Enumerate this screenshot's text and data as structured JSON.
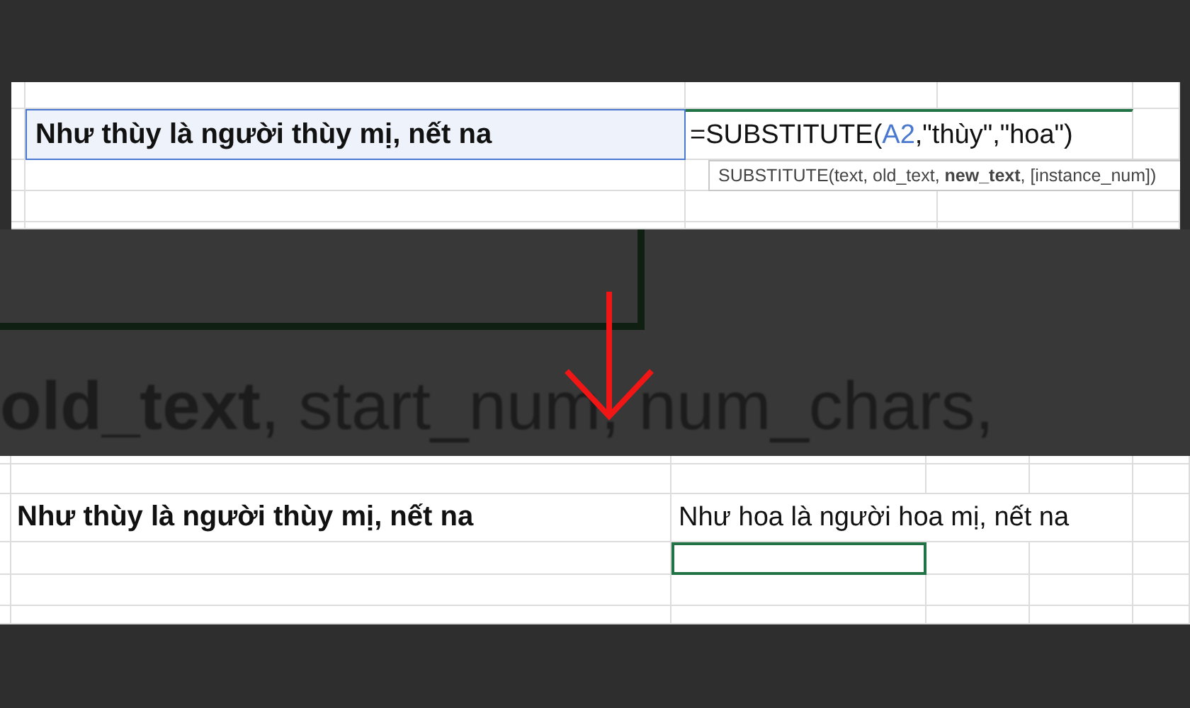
{
  "top_sheet": {
    "source_cell": {
      "text": "Như thùy là người thùy mị, nết na",
      "selected": true
    },
    "formula_cell": {
      "prefix": "=SUBSTITUTE(",
      "reference": "A2",
      "rest": ",\"thùy\",\"hoa\")"
    },
    "tooltip": "SUBSTITUTE(text, old_text, **new_text**, [instance_num])"
  },
  "blurred_hint": "**old_text**, start_num, num_chars,",
  "bottom_sheet": {
    "source_cell": {
      "text": "Như thùy là người thùy mị, nết na",
      "selected": false
    },
    "result_cell": {
      "text": "Như hoa là người hoa mị, nết na",
      "selected": false
    },
    "empty_cell": {
      "selected": true
    }
  }
}
